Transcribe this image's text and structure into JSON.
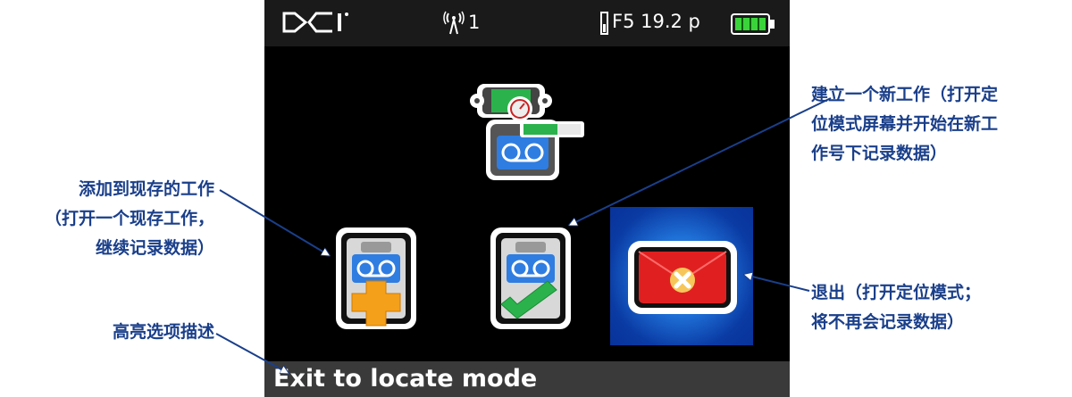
{
  "status_bar": {
    "logo_icon": "dci-logo",
    "signal_icon": "antenna-icon",
    "signal_count": "1",
    "frequency_icon": "frequency-block-icon",
    "frequency": "F5 19.2 p",
    "battery_icon": "battery-full-icon"
  },
  "menu": {
    "top_icon": "transmitter-record-icon",
    "options": [
      {
        "icon": "add-to-existing-job-icon"
      },
      {
        "icon": "new-job-icon"
      },
      {
        "icon": "exit-icon",
        "highlighted": true
      }
    ]
  },
  "caption": "Exit to locate mode",
  "annotations": {
    "add_existing": [
      "添加到现存的工作",
      "（打开一个现存工作，",
      "继续记录数据）"
    ],
    "highlight": "高亮选项描述",
    "new_job": [
      "建立一个新工作（打开定",
      "位模式屏幕并开始在新工",
      "作号下记录数据）"
    ],
    "exit": [
      "退出（打开定位模式；",
      "将不再会记录数据）"
    ]
  },
  "colors": {
    "annotation_text": "#1a3f8a",
    "highlight_bg": "#1e6fd6",
    "exit_red": "#e02020",
    "check_green": "#2bb24c",
    "plus_orange": "#f5a01a",
    "tape_blue": "#2f7de1",
    "battery_green": "#3ad43a"
  }
}
